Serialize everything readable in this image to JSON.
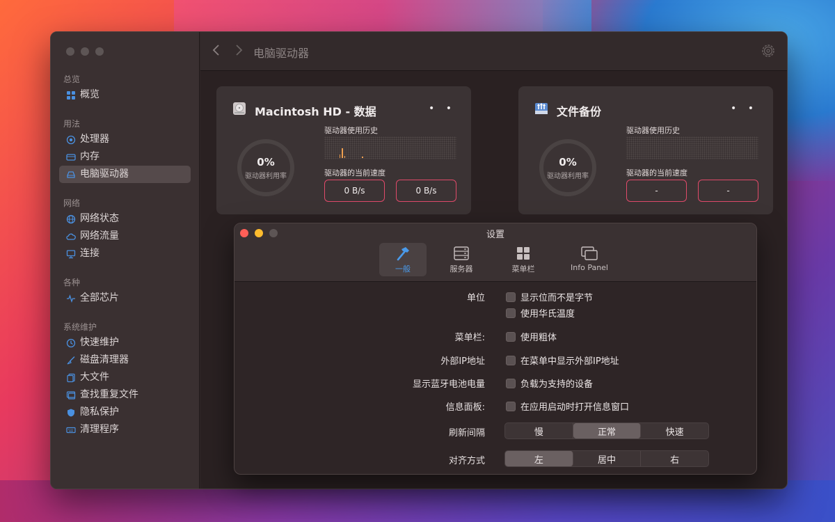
{
  "app": {
    "toolbar_title": "电脑驱动器"
  },
  "sidebar": {
    "sections": [
      {
        "title": "总览",
        "items": [
          {
            "label": "概览",
            "icon": "grid-icon"
          }
        ]
      },
      {
        "title": "用法",
        "items": [
          {
            "label": "处理器",
            "icon": "cpu-icon"
          },
          {
            "label": "内存",
            "icon": "memory-icon"
          },
          {
            "label": "电脑驱动器",
            "icon": "drive-icon",
            "active": true
          }
        ]
      },
      {
        "title": "网络",
        "items": [
          {
            "label": "网络状态",
            "icon": "globe-icon"
          },
          {
            "label": "网络流量",
            "icon": "cloud-icon"
          },
          {
            "label": "连接",
            "icon": "monitor-icon"
          }
        ]
      },
      {
        "title": "各种",
        "items": [
          {
            "label": "全部芯片",
            "icon": "pulse-icon"
          }
        ]
      },
      {
        "title": "系统维护",
        "items": [
          {
            "label": "快速维护",
            "icon": "clock-icon"
          },
          {
            "label": "磁盘清理器",
            "icon": "broom-icon"
          },
          {
            "label": "大文件",
            "icon": "files-icon"
          },
          {
            "label": "查找重复文件",
            "icon": "duplicate-icon"
          },
          {
            "label": "隐私保护",
            "icon": "shield-icon"
          },
          {
            "label": "清理程序",
            "icon": "keyboard-icon"
          }
        ]
      }
    ]
  },
  "cards": [
    {
      "title": "Macintosh HD - 数据",
      "usage_pct": "0%",
      "usage_label": "驱动器利用率",
      "history_label": "驱动器使用历史",
      "speed_label": "驱动器的当前速度",
      "read_speed": "0 B/s",
      "write_speed": "0 B/s",
      "dots": "• •"
    },
    {
      "title": "文件备份",
      "usage_pct": "0%",
      "usage_label": "驱动器利用率",
      "history_label": "驱动器使用历史",
      "speed_label": "驱动器的当前速度",
      "read_speed": "-",
      "write_speed": "-",
      "dots": "• •"
    }
  ],
  "dialog": {
    "title": "设置",
    "tabs": [
      {
        "label": "一般",
        "icon": "hammer-icon",
        "active": true
      },
      {
        "label": "服务器",
        "icon": "server-icon"
      },
      {
        "label": "菜单栏",
        "icon": "grid-icon"
      },
      {
        "label": "Info Panel",
        "icon": "windows-icon"
      }
    ],
    "settings": {
      "unit_label": "单位",
      "unit_bits": "显示位而不是字节",
      "unit_fahrenheit": "使用华氏温度",
      "menubar_label": "菜单栏:",
      "menubar_bold": "使用粗体",
      "external_ip_label": "外部IP地址",
      "external_ip_option": "在菜单中显示外部IP地址",
      "bluetooth_label": "显示蓝牙电池电量",
      "bluetooth_option": "负载为支持的设备",
      "info_panel_label": "信息面板:",
      "info_panel_option": "在应用启动时打开信息窗口",
      "refresh_label": "刷新间隔",
      "refresh_options": [
        "慢",
        "正常",
        "快速"
      ],
      "refresh_selected": "正常",
      "align_label": "对齐方式",
      "align_options": [
        "左",
        "居中",
        "右"
      ],
      "align_selected": "左"
    }
  },
  "colors": {
    "accent": "#4a9aea",
    "speed_border": "#e04a6a",
    "close": "#ff5f57",
    "minimize": "#febc2e",
    "zoom_inactive": "#5d5555"
  }
}
